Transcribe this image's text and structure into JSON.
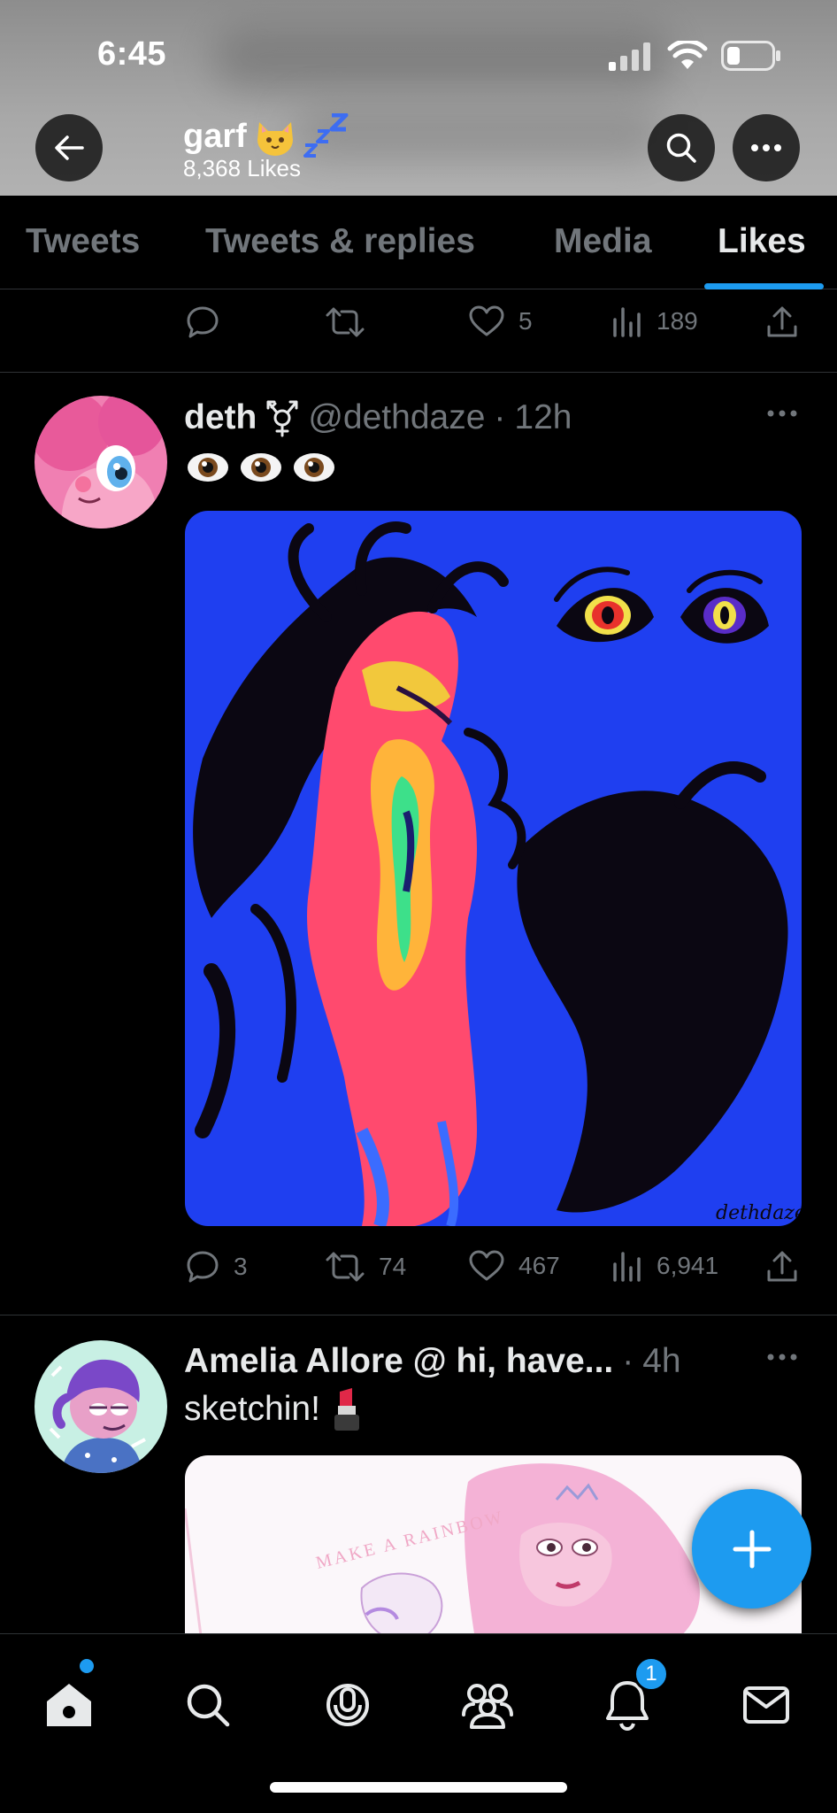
{
  "status_bar": {
    "time": "6:45"
  },
  "header": {
    "title": "garf",
    "subtitle": "8,368 Likes"
  },
  "tabs": [
    {
      "label": "Tweets",
      "active": false
    },
    {
      "label": "Tweets & replies",
      "active": false
    },
    {
      "label": "Media",
      "active": false
    },
    {
      "label": "Likes",
      "active": true
    }
  ],
  "previous_tweet_actions": {
    "replies": "",
    "retweets": "",
    "likes": "5",
    "views": "189"
  },
  "tweets": [
    {
      "name": "deth",
      "handle": "@dethdaze",
      "time": "12h",
      "text": "",
      "emoji_name": "eyes-emoji",
      "media_signature": "dethdaze",
      "actions": {
        "replies": "3",
        "retweets": "74",
        "likes": "467",
        "views": "6,941"
      }
    },
    {
      "name": "Amelia Allore @ hi, have...",
      "handle": "",
      "time": "4h",
      "text": "sketchin!",
      "emoji_name": "lipstick-emoji",
      "media_text": "MAKE A RAINBOW"
    }
  ],
  "bottom_nav": [
    {
      "name": "home-icon",
      "dot": true
    },
    {
      "name": "search-icon"
    },
    {
      "name": "spaces-icon"
    },
    {
      "name": "communities-icon"
    },
    {
      "name": "notifications-icon",
      "badge": "1"
    },
    {
      "name": "messages-icon"
    }
  ],
  "colors": {
    "accent": "#1d9bf0",
    "muted": "#71767b",
    "text": "#e7e9ea",
    "divider": "#2f3336",
    "media_bg": "#1f3ff0"
  }
}
